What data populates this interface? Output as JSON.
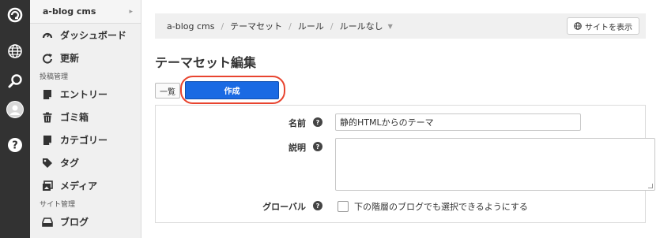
{
  "rail": {
    "items": [
      {
        "icon": "acms-logo-icon"
      },
      {
        "icon": "globe-icon"
      },
      {
        "icon": "search-icon"
      },
      {
        "icon": "avatar"
      },
      {
        "icon": "help-icon"
      }
    ]
  },
  "sidebar": {
    "site_name": "a-blog cms",
    "items_top": [
      {
        "label": "ダッシュボード",
        "icon": "dashboard-icon"
      },
      {
        "label": "更新",
        "icon": "refresh-icon"
      }
    ],
    "section_posts": "投稿管理",
    "items_posts": [
      {
        "label": "エントリー",
        "icon": "entry-icon"
      },
      {
        "label": "ゴミ箱",
        "icon": "trash-icon"
      },
      {
        "label": "カテゴリー",
        "icon": "category-icon"
      },
      {
        "label": "タグ",
        "icon": "tag-icon"
      },
      {
        "label": "メディア",
        "icon": "media-icon"
      }
    ],
    "section_site": "サイト管理",
    "items_site": [
      {
        "label": "ブログ",
        "icon": "blog-icon"
      }
    ]
  },
  "breadcrumb": [
    "a-blog cms",
    "テーマセット",
    "ルール",
    "ルールなし"
  ],
  "view_site_label": "サイトを表示",
  "page_title": "テーマセット編集",
  "list_button_label": "一覧",
  "create_button_label": "作成",
  "form": {
    "name_label": "名前",
    "name_value": "静的HTMLからのテーマ",
    "description_label": "説明",
    "description_value": "",
    "global_label": "グローバル",
    "global_checkbox_label": "下の階層のブログでも選択できるようにする",
    "global_checked": false
  },
  "colors": {
    "rail_bg": "#323232",
    "primary_button": "#1a6ae3",
    "highlight_outline": "#e8442f"
  }
}
